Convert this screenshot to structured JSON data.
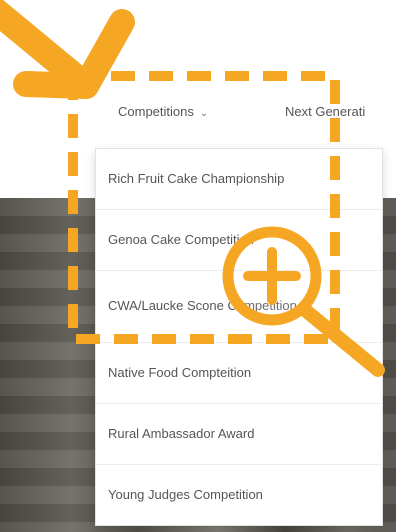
{
  "nav": {
    "competitions_label": "Competitions",
    "next_label": "Next Generati"
  },
  "dropdown": {
    "items": [
      {
        "label": "Rich Fruit Cake Championship"
      },
      {
        "label": "Genoa Cake Competition"
      },
      {
        "label": "CWA/Laucke Scone Competition"
      },
      {
        "label": "Native Food Compteition"
      },
      {
        "label": "Rural Ambassador Award"
      },
      {
        "label": "Young Judges Competition"
      }
    ]
  },
  "colors": {
    "accent": "#f5a623",
    "text": "#555555"
  },
  "icons": [
    "arrow-icon",
    "chevron-down-icon",
    "zoom-in-icon"
  ]
}
